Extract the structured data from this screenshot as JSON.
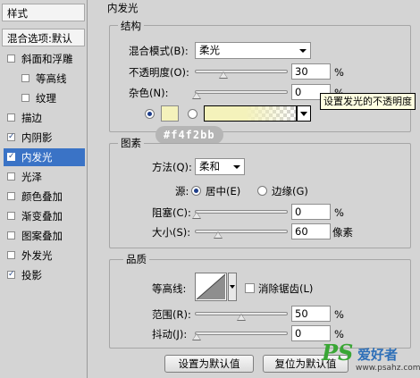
{
  "left_panel": {
    "header": "样式",
    "blend_options": "混合选项:默认",
    "items": [
      {
        "label": "斜面和浮雕",
        "checked": false,
        "indent": false,
        "selected": false
      },
      {
        "label": "等高线",
        "checked": false,
        "indent": true,
        "selected": false
      },
      {
        "label": "纹理",
        "checked": false,
        "indent": true,
        "selected": false
      },
      {
        "label": "描边",
        "checked": false,
        "indent": false,
        "selected": false
      },
      {
        "label": "内阴影",
        "checked": true,
        "indent": false,
        "selected": false
      },
      {
        "label": "内发光",
        "checked": true,
        "indent": false,
        "selected": true
      },
      {
        "label": "光泽",
        "checked": false,
        "indent": false,
        "selected": false
      },
      {
        "label": "颜色叠加",
        "checked": false,
        "indent": false,
        "selected": false
      },
      {
        "label": "渐变叠加",
        "checked": false,
        "indent": false,
        "selected": false
      },
      {
        "label": "图案叠加",
        "checked": false,
        "indent": false,
        "selected": false
      },
      {
        "label": "外发光",
        "checked": false,
        "indent": false,
        "selected": false
      },
      {
        "label": "投影",
        "checked": true,
        "indent": false,
        "selected": false
      }
    ]
  },
  "panel_title": "内发光",
  "structure": {
    "title": "结构",
    "blend_mode_label": "混合模式(B):",
    "blend_mode_value": "柔光",
    "opacity_label": "不透明度(O):",
    "opacity_value": "30",
    "opacity_unit": "%",
    "opacity_fraction": 0.3,
    "noise_label": "杂色(N):",
    "noise_value": "0",
    "noise_unit": "%",
    "noise_fraction": 0.0,
    "tooltip": "设置发光的不透明度",
    "swatch_color": "#f4f2bb"
  },
  "color_tag": "#f4f2bb",
  "elements": {
    "title": "图素",
    "method_label": "方法(Q):",
    "method_value": "柔和",
    "source_label": "源:",
    "source_center": "居中(E)",
    "source_edge": "边缘(G)",
    "choke_label": "阻塞(C):",
    "choke_value": "0",
    "choke_unit": "%",
    "choke_fraction": 0.0,
    "size_label": "大小(S):",
    "size_value": "60",
    "size_unit": "像素",
    "size_fraction": 0.24
  },
  "quality": {
    "title": "品质",
    "contour_label": "等高线:",
    "antialias_label": "消除锯齿(L)",
    "range_label": "范围(R):",
    "range_value": "50",
    "range_unit": "%",
    "range_fraction": 0.5,
    "jitter_label": "抖动(J):",
    "jitter_value": "0",
    "jitter_unit": "%",
    "jitter_fraction": 0.0
  },
  "buttons": {
    "set_default": "设置为默认值",
    "reset_default": "复位为默认值"
  },
  "watermark": {
    "logo": "PS",
    "logo_cn": "爱好者",
    "url": "www.psahz.com"
  },
  "colors": {
    "accent_selected": "#3a73c6",
    "logo_green": "#3aa635"
  }
}
